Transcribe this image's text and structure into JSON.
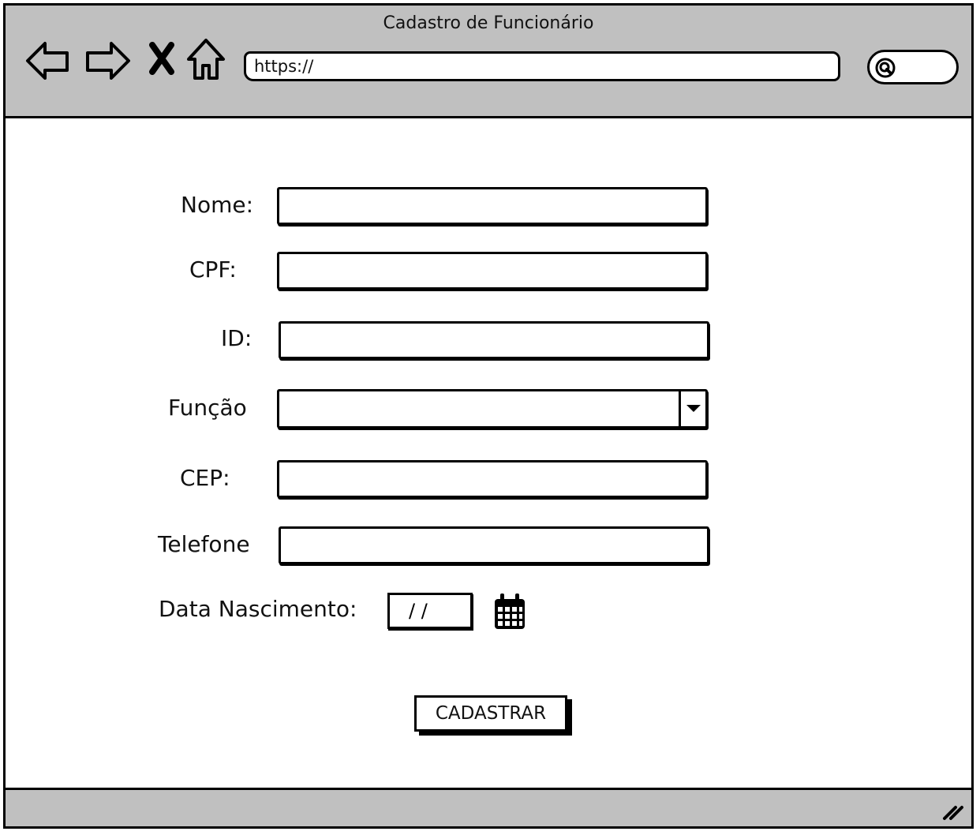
{
  "window": {
    "title": "Cadastro de Funcionário"
  },
  "browser": {
    "url": "https://",
    "nav_icons": [
      "back-arrow-icon",
      "forward-arrow-icon",
      "close-x-icon",
      "home-icon"
    ],
    "search_icon": "search-icon"
  },
  "form": {
    "fields": [
      {
        "label": "Nome:",
        "value": ""
      },
      {
        "label": "CPF:",
        "value": ""
      },
      {
        "label": "ID:",
        "value": ""
      },
      {
        "label": "Função",
        "value": ""
      },
      {
        "label": "CEP:",
        "value": ""
      },
      {
        "label": "Telefone",
        "value": ""
      }
    ],
    "birth_label": "Data Nascimento:",
    "birth_value": "/ /",
    "calendar_icon": "calendar-icon",
    "submit_label": "CADASTRAR"
  },
  "colors": {
    "chrome": "#c0c0c0",
    "stroke": "#000000",
    "background": "#ffffff"
  }
}
